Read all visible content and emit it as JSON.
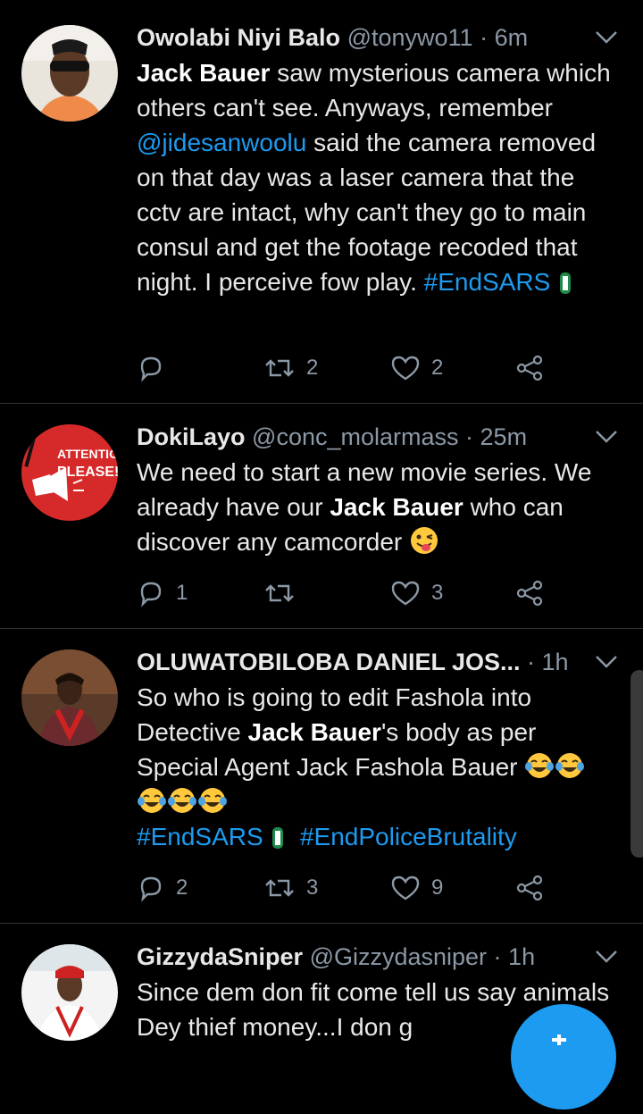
{
  "tweets": [
    {
      "name": "Owolabi Niyi Balo",
      "handle": "@tonywo11",
      "time": "6m",
      "body": [
        {
          "t": "b",
          "v": "Jack Bauer"
        },
        {
          "t": "s",
          "v": " saw mysterious camera which others can't see. Anyways, remember "
        },
        {
          "t": "l",
          "v": "@jidesanwoolu"
        },
        {
          "t": "s",
          "v": " said the camera removed on that day was a laser camera that the cctv are intact,  why can't they go to main consul and get the footage recoded that night. I perceive fow play. "
        },
        {
          "t": "l",
          "v": "#EndSARS"
        }
      ],
      "reply_count": "",
      "retweet_count": "2",
      "like_count": "2"
    },
    {
      "name": "DokiLayo",
      "handle": "@conc_molarmass",
      "time": "25m",
      "avatar_text": [
        "ATTENTIO",
        "PLEASE!"
      ],
      "body": [
        {
          "t": "s",
          "v": "We need to start a new movie series. We already have our "
        },
        {
          "t": "b",
          "v": "Jack Bauer"
        },
        {
          "t": "s",
          "v": " who can discover any camcorder "
        }
      ],
      "reply_count": "1",
      "retweet_count": "",
      "like_count": "3"
    },
    {
      "name": "OLUWATOBILOBA DANIEL JOS...",
      "handle": "",
      "time": "1h",
      "body": [
        {
          "t": "s",
          "v": "So who is going to edit Fashola into Detective "
        },
        {
          "t": "b",
          "v": "Jack Bauer"
        },
        {
          "t": "s",
          "v": "'s body as per Special Agent Jack Fashola Bauer "
        }
      ],
      "hashtags": [
        "#EndSARS",
        "#EndPoliceBrutality"
      ],
      "reply_count": "2",
      "retweet_count": "3",
      "like_count": "9"
    },
    {
      "name": "GizzydaSniper",
      "handle": "@Gizzydasniper",
      "time": "1h",
      "body": [
        {
          "t": "s",
          "v": "Since dem don fit come tell us say animals Dey thief money...I don g"
        }
      ]
    }
  ],
  "separator": " · ",
  "colors": {
    "background": "#000000",
    "link": "#1d9bf0",
    "muted": "#8b98a5",
    "divider": "#2f3336"
  },
  "icons": [
    "chevron-down-icon",
    "reply-icon",
    "retweet-icon",
    "like-icon",
    "share-icon",
    "flag-emoji",
    "tongue-wink-emoji",
    "tears-of-joy-emoji",
    "compose-icon"
  ]
}
